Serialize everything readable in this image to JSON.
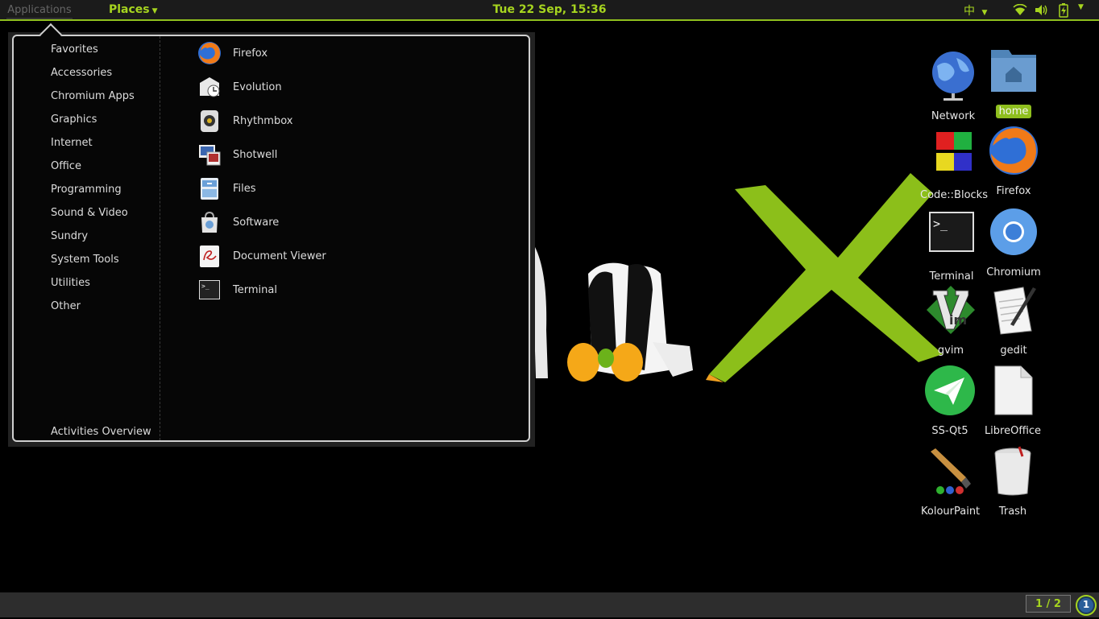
{
  "panel": {
    "applications_label": "Applications",
    "places_label": "Places",
    "clock": "Tue 22 Sep, 15:36",
    "input_method": "中"
  },
  "menu": {
    "categories": [
      "Favorites",
      "Accessories",
      "Chromium Apps",
      "Graphics",
      "Internet",
      "Office",
      "Programming",
      "Sound & Video",
      "Sundry",
      "System Tools",
      "Utilities",
      "Other"
    ],
    "activities_label": "Activities Overview",
    "apps": [
      {
        "label": "Firefox",
        "icon": "firefox-icon"
      },
      {
        "label": "Evolution",
        "icon": "evolution-icon"
      },
      {
        "label": "Rhythmbox",
        "icon": "rhythmbox-icon"
      },
      {
        "label": "Shotwell",
        "icon": "shotwell-icon"
      },
      {
        "label": "Files",
        "icon": "files-icon"
      },
      {
        "label": "Software",
        "icon": "software-icon"
      },
      {
        "label": "Document Viewer",
        "icon": "document-viewer-icon"
      },
      {
        "label": "Terminal",
        "icon": "terminal-icon"
      }
    ]
  },
  "desktop": {
    "icons": [
      {
        "label": "Network",
        "icon": "network-icon"
      },
      {
        "label": "home",
        "icon": "home-folder-icon",
        "selected": true
      },
      {
        "label": "Code::Blocks",
        "icon": "codeblocks-icon"
      },
      {
        "label": "Firefox",
        "icon": "firefox-icon"
      },
      {
        "label": "Terminal",
        "icon": "terminal-icon"
      },
      {
        "label": "Chromium",
        "icon": "chromium-icon"
      },
      {
        "label": "gvim",
        "icon": "gvim-icon"
      },
      {
        "label": "gedit",
        "icon": "gedit-icon"
      },
      {
        "label": "SS-Qt5",
        "icon": "ss-qt5-icon"
      },
      {
        "label": "LibreOffice",
        "icon": "libreoffice-icon"
      },
      {
        "label": "KolourPaint",
        "icon": "kolourpaint-icon"
      },
      {
        "label": "Trash",
        "icon": "trash-icon"
      }
    ]
  },
  "bottom": {
    "workspace": "1 / 2",
    "workspace_button": "1"
  },
  "colors": {
    "accent": "#a6d41f",
    "panel": "#1b1b1b",
    "menu_bg": "#060606"
  }
}
